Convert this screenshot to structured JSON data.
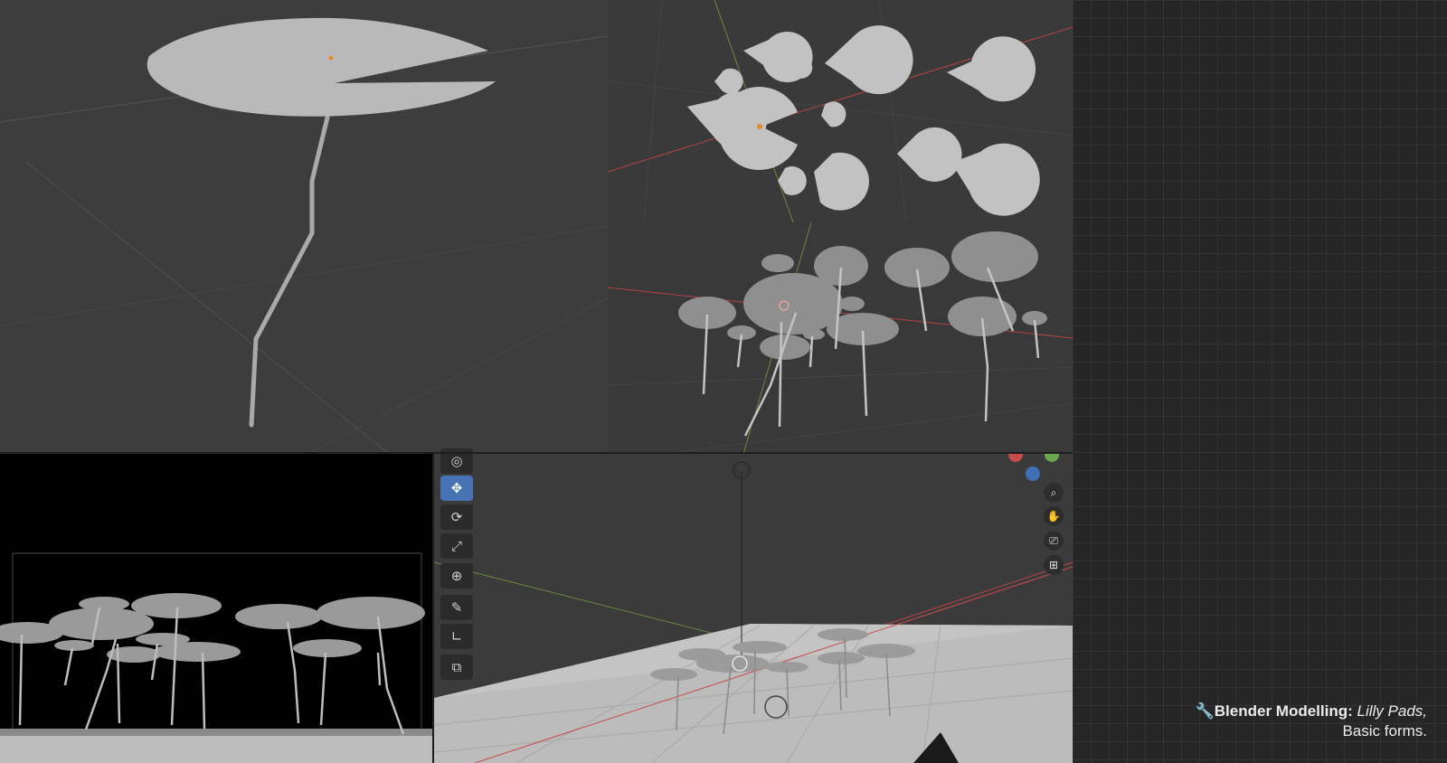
{
  "caption": {
    "icon": "wrench-icon",
    "title": "Blender Modelling:",
    "subject": "Lilly Pads,",
    "subtitle": "Basic forms."
  },
  "toolbar": {
    "tools": [
      {
        "name": "cursor-icon",
        "glyph": "◎",
        "active": false
      },
      {
        "name": "move-icon",
        "glyph": "✥",
        "active": true
      },
      {
        "name": "rotate-icon",
        "glyph": "⟳",
        "active": false
      },
      {
        "name": "scale-icon",
        "glyph": "⤢",
        "active": false
      },
      {
        "name": "transform-icon",
        "glyph": "⊕",
        "active": false
      },
      {
        "name": "annotate-icon",
        "glyph": "✎",
        "active": false
      },
      {
        "name": "measure-icon",
        "glyph": "∟",
        "active": false
      },
      {
        "name": "add-cube-icon",
        "glyph": "⧉",
        "active": false
      }
    ]
  },
  "navigation": {
    "buttons": [
      {
        "name": "zoom-icon",
        "glyph": "⌕"
      },
      {
        "name": "pan-hand-icon",
        "glyph": "✋"
      },
      {
        "name": "camera-view-icon",
        "glyph": "⎚"
      },
      {
        "name": "grid-perspective-icon",
        "glyph": "⊞"
      }
    ]
  },
  "colors": {
    "axis_x": "#c94a4a",
    "axis_y": "#6aa84f",
    "axis_z": "#3f6fb5",
    "active_tool": "#4772b3",
    "pad": "#b8b8b8"
  }
}
